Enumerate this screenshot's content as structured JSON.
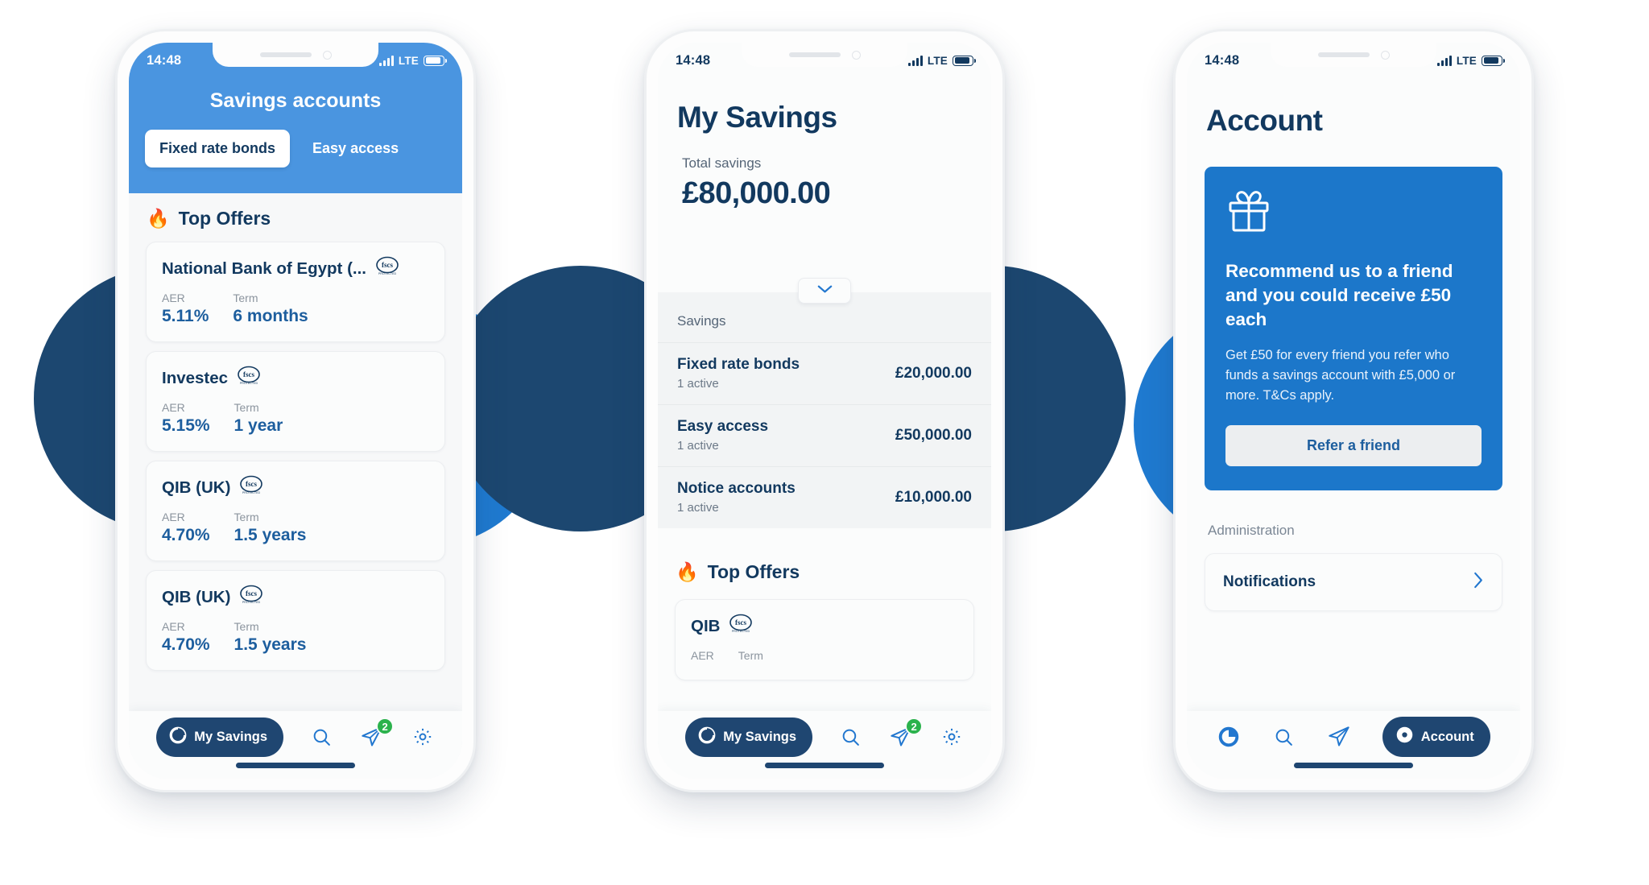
{
  "status_bar": {
    "time": "14:48",
    "network": "LTE"
  },
  "phone1": {
    "header": {
      "title": "Savings accounts",
      "tabs": [
        {
          "label": "Fixed rate bonds",
          "active": true
        },
        {
          "label": "Easy access",
          "active": false
        }
      ]
    },
    "top_offers_label": "Top Offers",
    "fire_icon": "fire-icon",
    "column_labels": {
      "aer": "AER",
      "term": "Term"
    },
    "offers": [
      {
        "name": "National Bank of Egypt (...",
        "aer": "5.11%",
        "term": "6 months",
        "fscs": true
      },
      {
        "name": "Investec",
        "aer": "5.15%",
        "term": "1 year",
        "fscs": true
      },
      {
        "name": "QIB (UK)",
        "aer": "4.70%",
        "term": "1.5 years",
        "fscs": true
      },
      {
        "name": "QIB (UK)",
        "aer": "4.70%",
        "term": "1.5 years",
        "fscs": true
      }
    ],
    "nav": {
      "active_label": "My Savings",
      "items": [
        "my-savings",
        "search",
        "send",
        "settings"
      ],
      "badge": "2"
    }
  },
  "phone2": {
    "title": "My Savings",
    "total_label": "Total savings",
    "total_value": "£80,000.00",
    "expand_icon": "chevron-down-icon",
    "savings_section_label": "Savings",
    "savings_rows": [
      {
        "name": "Fixed rate bonds",
        "sub": "1 active",
        "amount": "£20,000.00"
      },
      {
        "name": "Easy access",
        "sub": "1 active",
        "amount": "£50,000.00"
      },
      {
        "name": "Notice accounts",
        "sub": "1 active",
        "amount": "£10,000.00"
      }
    ],
    "top_offers_label": "Top Offers",
    "offer": {
      "name": "QIB",
      "aer_label": "AER",
      "term_label": "Term"
    },
    "nav": {
      "active_label": "My Savings",
      "badge": "2"
    }
  },
  "phone3": {
    "title": "Account",
    "refer_card": {
      "gift_icon": "gift-icon",
      "heading": "Recommend us to a friend and you could receive £50 each",
      "body": "Get £50 for every friend you refer who funds a savings account with £5,000 or more. T&Cs apply.",
      "button": "Refer a friend"
    },
    "admin_label": "Administration",
    "notifications": {
      "label": "Notifications",
      "chevron": "chevron-right-icon"
    },
    "nav": {
      "active_label": "Account"
    }
  },
  "colors": {
    "brand_blue": "#1c77ca",
    "header_blue": "#4a95e0",
    "navy": "#12395f",
    "pill_navy": "#1f4671",
    "badge_green": "#2bb24c",
    "circle_navy": "#1c4770",
    "circle_blue": "#1f7ad0"
  }
}
